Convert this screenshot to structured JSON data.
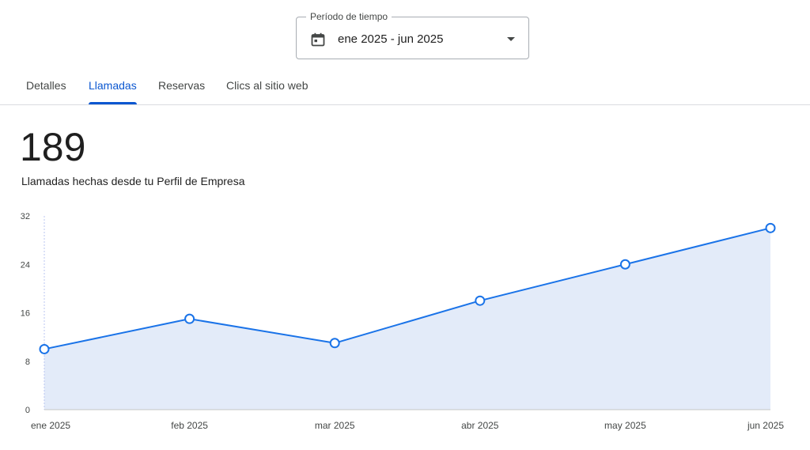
{
  "period": {
    "label": "Período de tiempo",
    "value": "ene 2025 - jun 2025",
    "calendar_icon": "calendar-icon",
    "caret_icon": "arrow-drop-down-icon"
  },
  "tabs": [
    {
      "label": "Detalles",
      "active": false
    },
    {
      "label": "Llamadas",
      "active": true
    },
    {
      "label": "Reservas",
      "active": false
    },
    {
      "label": "Clics al sitio web",
      "active": false
    }
  ],
  "metric": {
    "value": "189",
    "caption": "Llamadas hechas desde tu Perfil de Empresa"
  },
  "colors": {
    "accent": "#0b57d0",
    "line": "#1a73e8",
    "area": "#e3ebf9"
  },
  "chart_data": {
    "type": "area",
    "categories": [
      "ene 2025",
      "feb 2025",
      "mar 2025",
      "abr 2025",
      "may 2025",
      "jun 2025"
    ],
    "series": [
      {
        "values": [
          10,
          15,
          11,
          18,
          24,
          30
        ]
      }
    ],
    "yticks": [
      "0",
      "8",
      "16",
      "24",
      "32"
    ],
    "ylim": [
      0,
      32
    ],
    "grid": false,
    "markers": true
  }
}
